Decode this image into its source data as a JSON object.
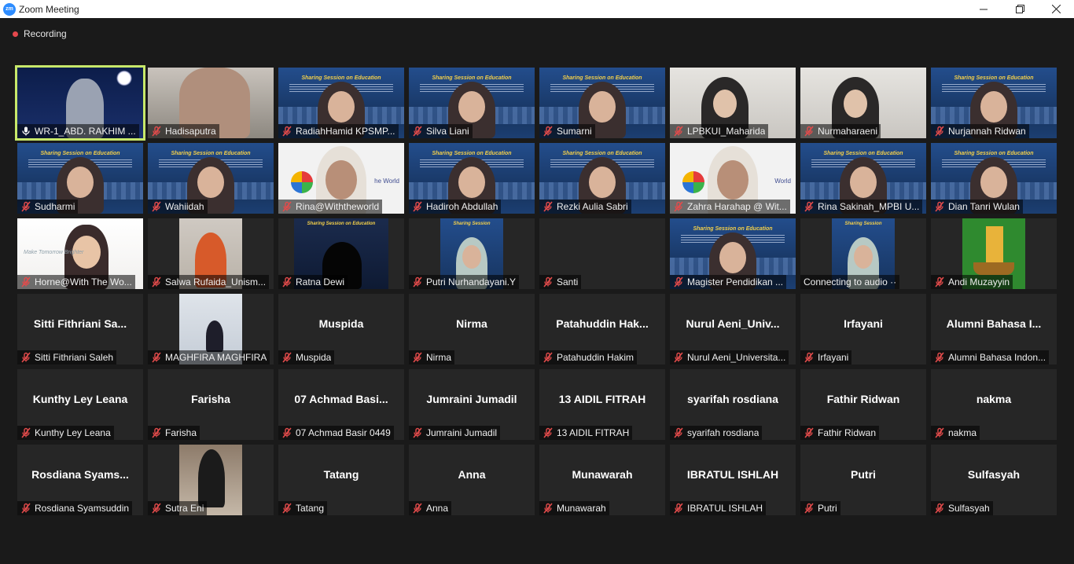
{
  "window": {
    "title": "Zoom Meeting",
    "app_icon_text": "zm"
  },
  "recording": {
    "label": "Recording"
  },
  "colors": {
    "active_speaker": "#c7e86a",
    "tile_bg": "#262626",
    "recording_dot": "#e5484d"
  },
  "participants": [
    {
      "name": "WR-1_ABD. RAKHIM ...",
      "video": "night",
      "active": true,
      "muted": false
    },
    {
      "name": "Hadisaputra",
      "video": "room",
      "muted": true
    },
    {
      "name": "RadiahHamid KPSMP...",
      "video": "banner",
      "muted": true
    },
    {
      "name": "Silva Liani",
      "video": "banner",
      "muted": true
    },
    {
      "name": "Sumarni",
      "video": "banner",
      "muted": true
    },
    {
      "name": "LPBKUI_Maharida",
      "video": "office",
      "muted": true
    },
    {
      "name": "Nurmaharaeni",
      "video": "office",
      "muted": true
    },
    {
      "name": "Nurjannah Ridwan",
      "video": "banner",
      "muted": true
    },
    {
      "name": "Sudharmi",
      "video": "banner",
      "muted": true
    },
    {
      "name": "Wahiidah",
      "video": "banner",
      "muted": true
    },
    {
      "name": "Rina@Withtheworld",
      "video": "white",
      "muted": true,
      "overlay_text": "he World"
    },
    {
      "name": "Hadiroh Abdullah",
      "video": "banner",
      "muted": true
    },
    {
      "name": "Rezki Aulia Sabri",
      "video": "banner",
      "muted": true
    },
    {
      "name": "Zahra Harahap @ Wit...",
      "video": "white",
      "muted": true,
      "overlay_text": "World"
    },
    {
      "name": "Rina Sakinah_MPBI U...",
      "video": "banner",
      "muted": true
    },
    {
      "name": "Dian Tanri Wulan",
      "video": "banner",
      "muted": true
    },
    {
      "name": "Horne@With The Wo...",
      "video": "bright",
      "muted": true,
      "overlay_text": "Make Tomorrow Brighter"
    },
    {
      "name": "Salwa Rufaida_Unism...",
      "video": "thumb-orange",
      "muted": true
    },
    {
      "name": "Ratna Dewi",
      "video": "thumb-dark",
      "muted": true
    },
    {
      "name": "Putri Nurhandayani.Y",
      "video": "thumb-banner",
      "muted": true
    },
    {
      "name": "Santi",
      "video": "none",
      "muted": true
    },
    {
      "name": "Magister Pendidikan ...",
      "video": "banner",
      "muted": true
    },
    {
      "name": "Connecting to audio ··",
      "video": "thumb-banner",
      "muted": false
    },
    {
      "name": "Andi Muzayyin",
      "video": "thumb-ship",
      "muted": true
    },
    {
      "name": "Sitti Fithriani Saleh",
      "display": "Sitti Fithriani Sa...",
      "video": "none",
      "muted": true
    },
    {
      "name": "MAGHFIRA MAGHFIRA",
      "video": "thumb-snow",
      "muted": true
    },
    {
      "name": "Muspida",
      "display": "Muspida",
      "video": "none",
      "muted": true
    },
    {
      "name": "Nirma",
      "display": "Nirma",
      "video": "none",
      "muted": true
    },
    {
      "name": "Patahuddin Hakim",
      "display": "Patahuddin  Hak...",
      "video": "none",
      "muted": true
    },
    {
      "name": "Nurul Aeni_Universita...",
      "display": "Nurul  Aeni_Univ...",
      "video": "none",
      "muted": true
    },
    {
      "name": "Irfayani",
      "display": "Irfayani",
      "video": "none",
      "muted": true
    },
    {
      "name": "Alumni Bahasa Indon...",
      "display": "Alumni Bahasa I...",
      "video": "none",
      "muted": true
    },
    {
      "name": "Kunthy Ley Leana",
      "display": "Kunthy Ley Leana",
      "video": "none",
      "muted": true
    },
    {
      "name": "Farisha",
      "display": "Farisha",
      "video": "none",
      "muted": true
    },
    {
      "name": "07 Achmad Basir 0449",
      "display": "07  Achmad Basi...",
      "video": "none",
      "muted": true
    },
    {
      "name": "Jumraini Jumadil",
      "display": "Jumraini Jumadil",
      "video": "none",
      "muted": true
    },
    {
      "name": "13 AIDIL FITRAH",
      "display": "13 AIDIL FITRAH",
      "video": "none",
      "muted": true
    },
    {
      "name": "syarifah rosdiana",
      "display": "syarifah rosdiana",
      "video": "none",
      "muted": true
    },
    {
      "name": "Fathir Ridwan",
      "display": "Fathir Ridwan",
      "video": "none",
      "muted": true
    },
    {
      "name": "nakma",
      "display": "nakma",
      "video": "none",
      "muted": true
    },
    {
      "name": "Rosdiana Syamsuddin",
      "display": "Rosdiana  Syams...",
      "video": "none",
      "muted": true
    },
    {
      "name": "Sutra Eni",
      "video": "thumb-photo",
      "muted": true
    },
    {
      "name": "Tatang",
      "display": "Tatang",
      "video": "none",
      "muted": true
    },
    {
      "name": "Anna",
      "display": "Anna",
      "video": "none",
      "muted": true
    },
    {
      "name": "Munawarah",
      "display": "Munawarah",
      "video": "none",
      "muted": true
    },
    {
      "name": "IBRATUL ISHLAH",
      "display": "IBRATUL ISHLAH",
      "video": "none",
      "muted": true
    },
    {
      "name": "Putri",
      "display": "Putri",
      "video": "none",
      "muted": true
    },
    {
      "name": "Sulfasyah",
      "display": "Sulfasyah",
      "video": "none",
      "muted": true
    }
  ]
}
